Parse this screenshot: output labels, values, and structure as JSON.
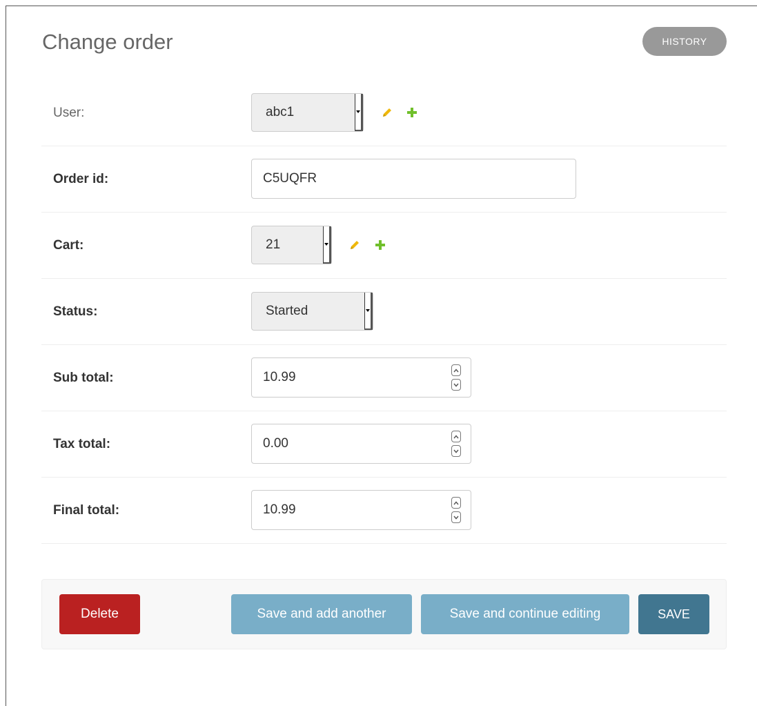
{
  "header": {
    "title": "Change order",
    "history_label": "HISTORY"
  },
  "fields": {
    "user": {
      "label": "User:",
      "selected": "abc1"
    },
    "order_id": {
      "label": "Order id:",
      "value": "C5UQFR"
    },
    "cart": {
      "label": "Cart:",
      "selected": "21"
    },
    "status": {
      "label": "Status:",
      "selected": "Started"
    },
    "sub_total": {
      "label": "Sub total:",
      "value": "10.99"
    },
    "tax_total": {
      "label": "Tax total:",
      "value": "0.00"
    },
    "final_total": {
      "label": "Final total:",
      "value": "10.99"
    }
  },
  "actions": {
    "delete_label": "Delete",
    "save_add_label": "Save and add another",
    "save_continue_label": "Save and continue editing",
    "save_label": "SAVE"
  },
  "icons": {
    "edit": "pencil-icon",
    "add": "plus-icon",
    "increment": "chevron-up-icon",
    "decrement": "chevron-down-icon"
  },
  "colors": {
    "history_bg": "#999999",
    "edit_icon": "#efb80b",
    "add_icon": "#70bf2b",
    "delete_bg": "#ba2121",
    "secondary_save_bg": "#79aec8",
    "primary_save_bg": "#417690"
  }
}
